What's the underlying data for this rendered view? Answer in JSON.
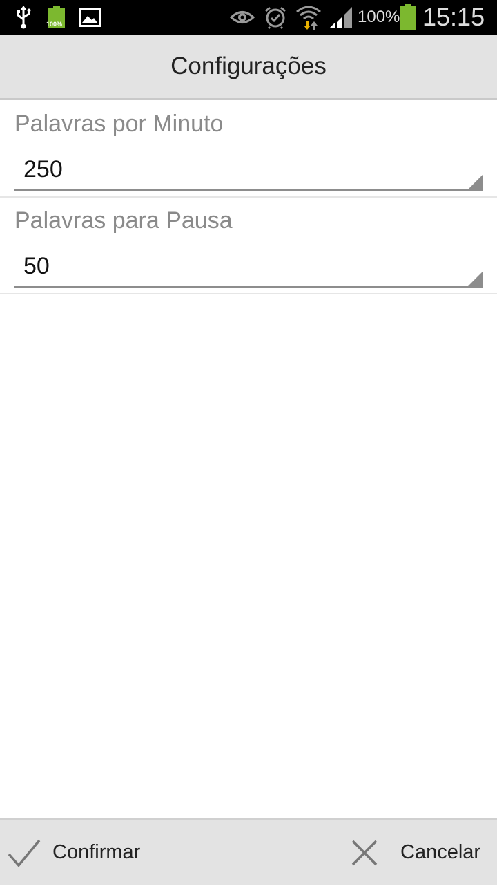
{
  "status_bar": {
    "battery_small_label": "100%",
    "battery_percent": "100%",
    "time": "15:15",
    "icons": [
      "usb-icon",
      "battery-small-icon",
      "image-icon",
      "eye-icon",
      "alarm-icon",
      "wifi-icon",
      "signal-icon",
      "battery-icon"
    ],
    "colors": {
      "battery": "#7cb82f",
      "wifi_arrow": "#e8b000"
    }
  },
  "header": {
    "title": "Configurações"
  },
  "preferences": [
    {
      "label": "Palavras por Minuto",
      "value": "250"
    },
    {
      "label": "Palavras para Pausa",
      "value": "50"
    }
  ],
  "footer": {
    "confirm_label": "Confirmar",
    "cancel_label": "Cancelar",
    "icons": [
      "check-icon",
      "close-icon"
    ]
  }
}
